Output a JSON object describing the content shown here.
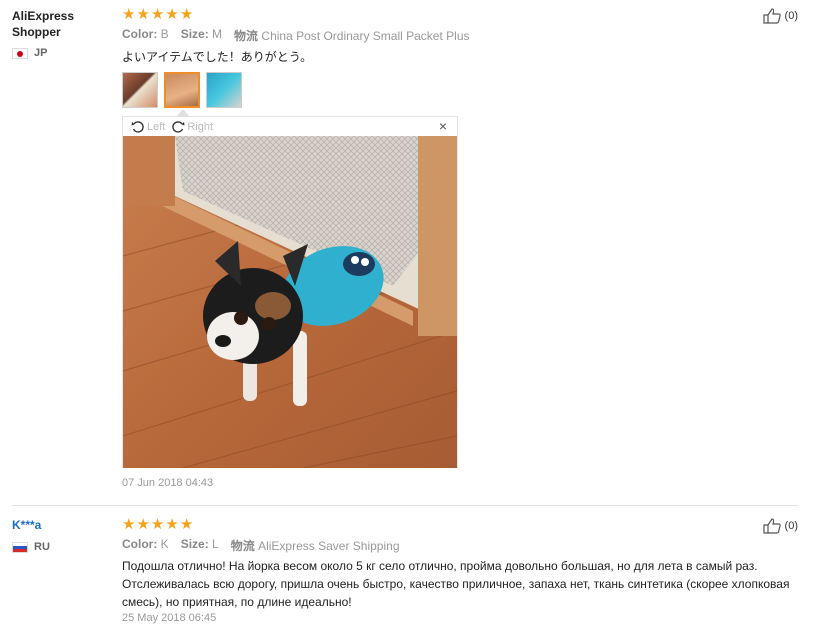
{
  "reviews": [
    {
      "user": "AliExpress Shopper",
      "country": "JP",
      "stars": 5,
      "color_label": "Color:",
      "color_value": "B",
      "size_label": "Size:",
      "size_value": "M",
      "shipping_label": "物流",
      "shipping_value": "China Post Ordinary Small Packet Plus",
      "text": "よいアイテムでした！ありがとう。",
      "helpful": "(0)",
      "date": "07 Jun 2018 04:43",
      "viewer": {
        "rotate_left": "Left",
        "rotate_right": "Right",
        "close": "×"
      }
    },
    {
      "user": "K***a",
      "country": "RU",
      "stars": 5,
      "color_label": "Color:",
      "color_value": "K",
      "size_label": "Size:",
      "size_value": "L",
      "shipping_label": "物流",
      "shipping_value": "AliExpress Saver Shipping",
      "text": "Подошла отлично! На йорка весом около 5 кг село отлично, пройма довольно большая, но для лета в самый раз. Отслеживалась всю дорогу, пришла очень быстро, качество приличное, запаха нет, ткань синтетика (скорее хлопковая смесь), но приятная, по длине идеально!",
      "helpful": "(0)",
      "date": "25 May 2018 06:45"
    }
  ],
  "colors": {
    "star": "#f4a31c",
    "link": "#1a6fc9",
    "selected_border": "#f08c2b"
  },
  "icons": {
    "star": "star-icon",
    "thumbs_up": "thumbs-up-icon",
    "rotate_left": "rotate-left-icon",
    "rotate_right": "rotate-right-icon",
    "close": "close-icon"
  }
}
